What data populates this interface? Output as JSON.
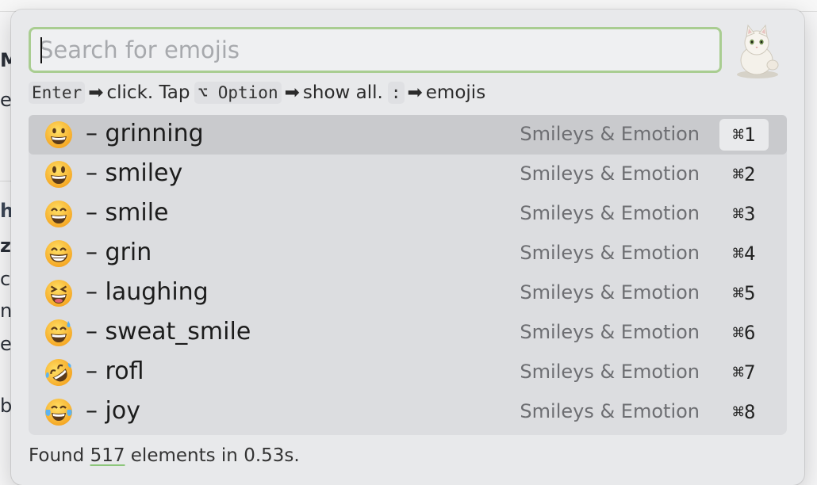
{
  "search": {
    "placeholder": "Search for emojis",
    "value": ""
  },
  "hint": {
    "enter_key": "Enter",
    "enter_action": "click. Tap",
    "option_key": "⌥ Option",
    "option_action": "show all.",
    "colon_key": ":",
    "colon_action": "emojis",
    "arrow": "➡"
  },
  "results": [
    {
      "emoji": "grinning-face-icon",
      "label": "– grinning",
      "category": "Smileys & Emotion",
      "shortcut": "⌘1",
      "selected": true
    },
    {
      "emoji": "smiley-face-icon",
      "label": "– smiley",
      "category": "Smileys & Emotion",
      "shortcut": "⌘2",
      "selected": false
    },
    {
      "emoji": "smile-face-icon",
      "label": "– smile",
      "category": "Smileys & Emotion",
      "shortcut": "⌘3",
      "selected": false
    },
    {
      "emoji": "grin-face-icon",
      "label": "– grin",
      "category": "Smileys & Emotion",
      "shortcut": "⌘4",
      "selected": false
    },
    {
      "emoji": "laughing-face-icon",
      "label": "– laughing",
      "category": "Smileys & Emotion",
      "shortcut": "⌘5",
      "selected": false
    },
    {
      "emoji": "sweat-smile-face-icon",
      "label": "– sweat_smile",
      "category": "Smileys & Emotion",
      "shortcut": "⌘6",
      "selected": false
    },
    {
      "emoji": "rofl-face-icon",
      "label": "– rofl",
      "category": "Smileys & Emotion",
      "shortcut": "⌘7",
      "selected": false
    },
    {
      "emoji": "joy-face-icon",
      "label": "– joy",
      "category": "Smileys & Emotion",
      "shortcut": "⌘8",
      "selected": false
    }
  ],
  "status": {
    "prefix": "Found",
    "count": "517",
    "suffix": "elements in 0.53s."
  },
  "colors": {
    "accent": "#a9cd91",
    "selected_row": "#c9cacd",
    "list_bg": "#dcdde0",
    "popup_bg": "#e8e9eb"
  },
  "background_fragments": [
    "M",
    "e",
    "h",
    "z",
    "c",
    "n",
    "e",
    "b"
  ]
}
